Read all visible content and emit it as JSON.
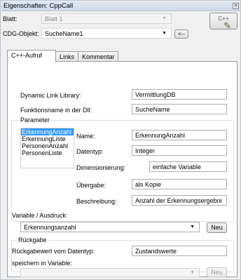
{
  "window": {
    "title": "Eigenschaften: CppCall",
    "close_glyph": "✕"
  },
  "header": {
    "blatt_label": "Blatt:",
    "blatt_value": "Blatt 1",
    "cdg_label": "CDG-Objekt:",
    "cdg_value": "SucheName1",
    "back_button": "<--",
    "cpp_button": "C++",
    "tool_icon_glyph": "✎"
  },
  "tabs": [
    {
      "label": "C++-Aufruf",
      "active": true
    },
    {
      "label": "Links",
      "active": false
    },
    {
      "label": "Kommentar",
      "active": false
    }
  ],
  "main": {
    "dll_label": "Dynamic Link Library:",
    "dll_value": "VermittlungDB",
    "func_label": "Funktionsname in der Dll:",
    "func_value": "SucheName"
  },
  "parameter": {
    "group_title": "Parameter",
    "items": [
      "ErkennungAnzahl",
      "ErkennungListe",
      "PersonenAnzahl",
      "PersonenListe"
    ],
    "selected_index": 0,
    "name_label": "Name:",
    "name_value": "ErkennungAnzahl",
    "datentyp_label": "Datentyp:",
    "datentyp_value": "Integer",
    "dim_label": "Dimensionierung:",
    "dim_value": "einfache Variable",
    "uebergabe_label": "Übergabe:",
    "uebergabe_value": "als Kopie",
    "beschr_label": "Beschreibung:",
    "beschr_value": "Anzahl der Erkennungsergebni",
    "variable_label": "Variable / Ausdruck:",
    "variable_value": "Erkennungsanzahl",
    "neu_button": "Neu"
  },
  "rueckgabe": {
    "group_title": "Rückgabe",
    "datentyp_label": "Rückgabewert vom Datentyp:",
    "datentyp_value": "Zustandswerte",
    "speichern_label": "speichern in Variable:",
    "speichern_value": "",
    "neu_button": "Neu"
  },
  "colors": {
    "selection": "#3399ff",
    "titlebar": "#dfe7f2"
  }
}
